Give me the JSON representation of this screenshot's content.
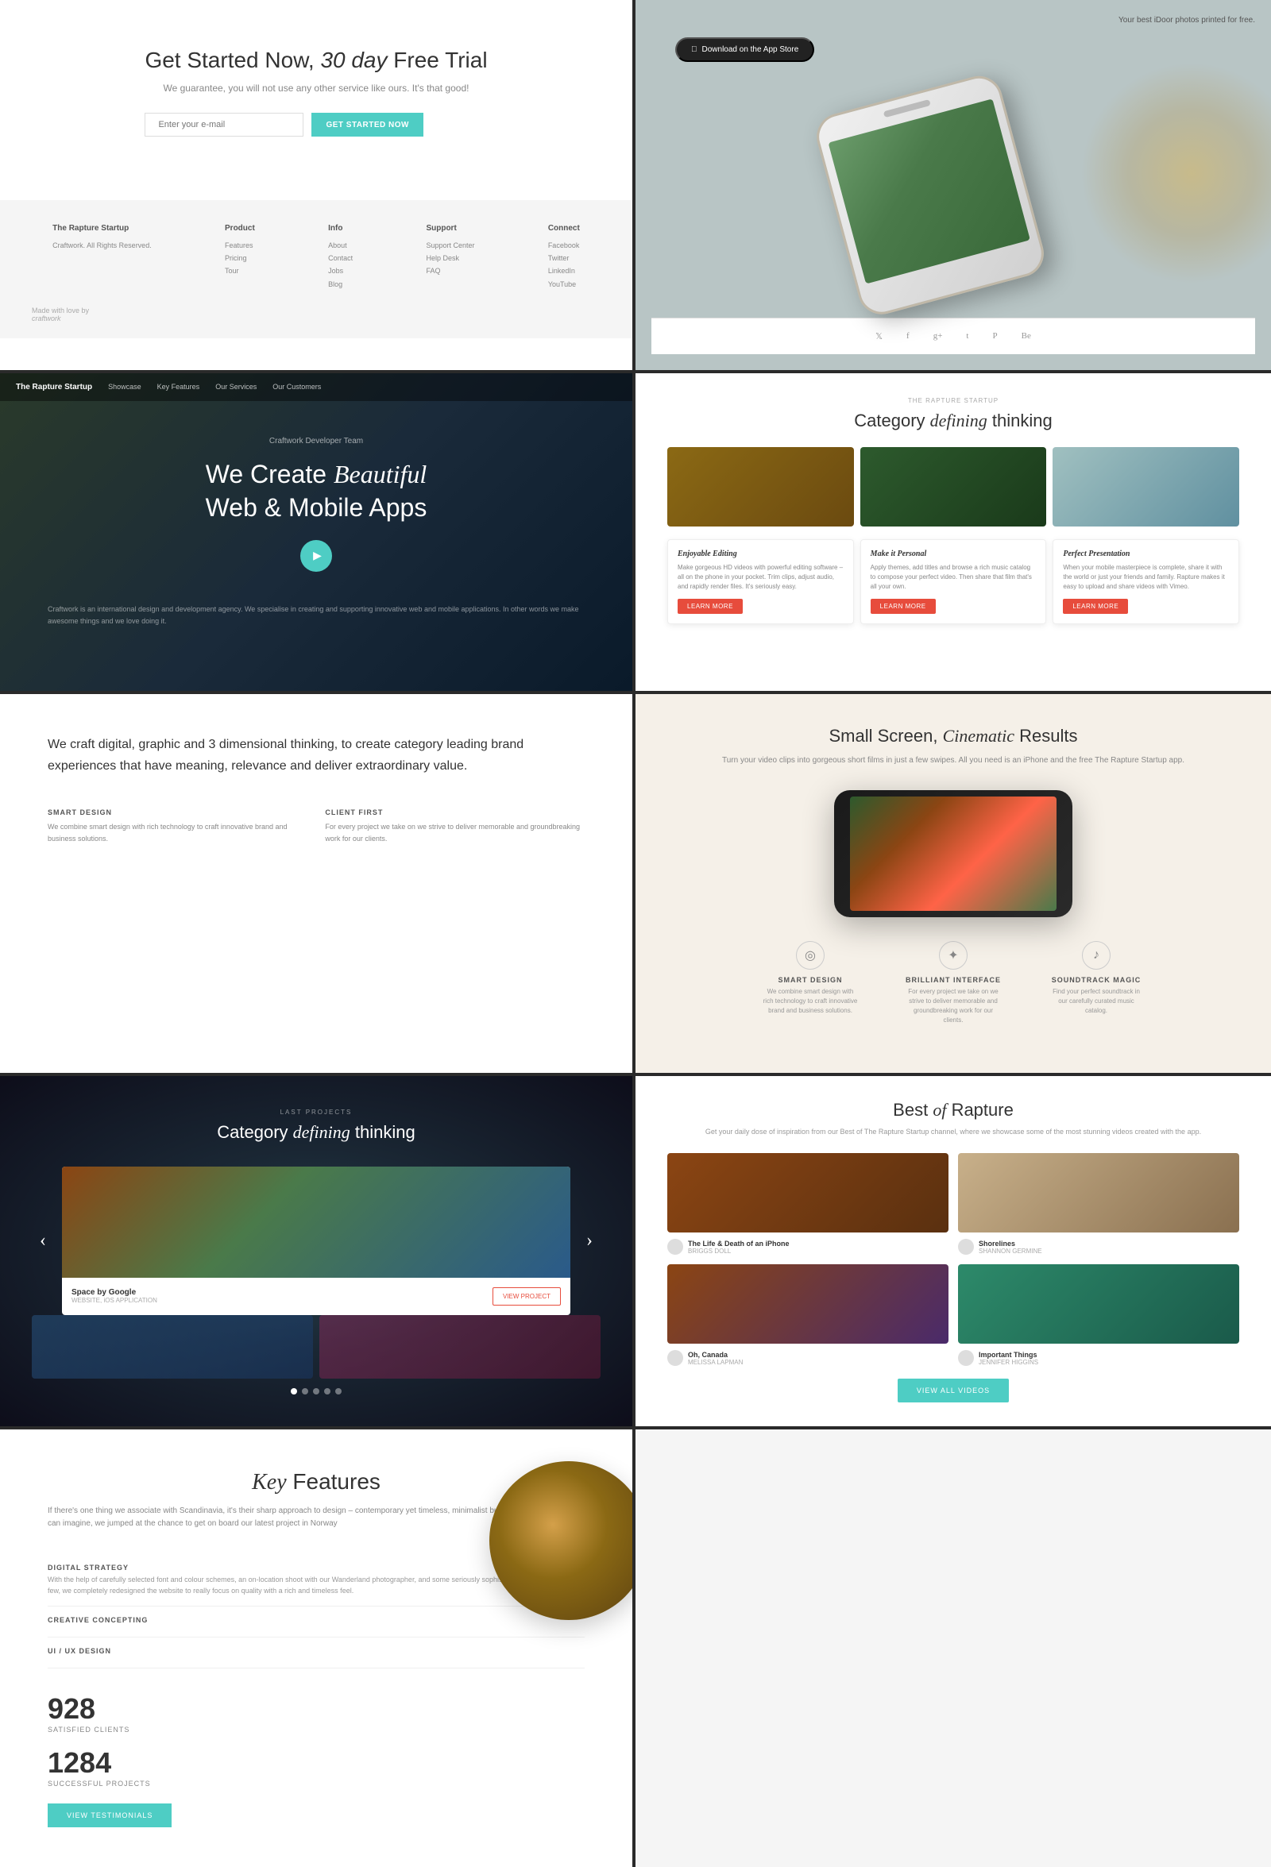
{
  "panel1": {
    "headline": "Get Started Now,",
    "headline_em": "30 day",
    "headline_end": "Free Trial",
    "subtitle": "We guarantee, you will not use any other service like ours. It's that good!",
    "email_placeholder": "Enter your e-mail",
    "cta_button": "GET STARTED NOW",
    "footer_brand": "The Rapture Startup",
    "footer_copy": "Craftwork. All Rights Reserved.",
    "footer_cols": [
      {
        "heading": "The Rapture Startup",
        "links": [
          "Craftwork. All Rights Reserved."
        ]
      },
      {
        "heading": "Product",
        "links": [
          "Features",
          "Pricing",
          "Tour"
        ]
      },
      {
        "heading": "Info",
        "links": [
          "About",
          "Contact",
          "Jobs",
          "Blog"
        ]
      },
      {
        "heading": "Support",
        "links": [
          "Support Center",
          "Help Desk",
          "FAQ"
        ]
      },
      {
        "heading": "Connect",
        "links": [
          "Facebook",
          "Twitter",
          "LinkedIn",
          "YouTube"
        ]
      }
    ],
    "logo": "craftwork"
  },
  "panel2": {
    "top_text": "Your best iDoor photos printed for free.",
    "app_store": "Download on the App Store",
    "social_icons": [
      "twitter",
      "facebook",
      "google-plus",
      "tumblr",
      "pinterest",
      "behance"
    ]
  },
  "panel3": {
    "nav_brand": "The Rapture Startup",
    "nav_links": [
      "Showcase",
      "Key Features",
      "Our Services",
      "Our Customers"
    ],
    "small_label": "Craftwork Developer Team",
    "headline": "We Create",
    "headline_em": "Beautiful",
    "headline_line2": "Web & Mobile Apps",
    "body_text": "Craftwork is an international design and development agency. We specialise in creating and supporting innovative web and mobile applications. In other words we make awesome things and we love doing it."
  },
  "panel4": {
    "brand": "THE RAPTURE STARTUP",
    "headline": "Category",
    "headline_em": "defining",
    "headline_end": "thinking",
    "cards": [
      {
        "title": "Enjoyable Editing",
        "desc": "Make gorgeous HD videos with powerful editing software – all on the phone in your pocket. Trim clips, adjust audio, and rapidly render files. It's seriously easy.",
        "btn": "LEARN MORE"
      },
      {
        "title": "Make it Personal",
        "desc": "Apply themes, add titles and browse a rich music catalog to compose your perfect video. Then share that film that's all your own.",
        "btn": "LEARN MORE"
      },
      {
        "title": "Perfect Presentation",
        "desc": "When your mobile masterpiece is complete, share it with the world or just your friends and family. Rapture makes it easy to upload and share videos with Vimeo.",
        "btn": "LEARN MORE"
      }
    ]
  },
  "panel5": {
    "main_text": "We craft digital, graphic and 3 dimensional thinking, to create category leading brand experiences that have meaning, relevance and deliver extraordinary value.",
    "col1_title": "SMART DESIGN",
    "col1_text": "We combine smart design with rich technology to craft innovative brand and business solutions.",
    "col2_title": "CLIENT FIRST",
    "col2_text": "For every project we take on we strive to deliver memorable and groundbreaking work for our clients."
  },
  "panel6": {
    "headline": "Small Screen,",
    "headline_em": "Cinematic",
    "headline_end": "Results",
    "subtitle": "Turn your video clips into gorgeous short films in just a few swipes.\nAll you need is an iPhone and the free The Rapture Startup app.",
    "features": [
      {
        "icon": "◎",
        "title": "SMART DESIGN",
        "desc": "We combine smart design with rich technology to craft innovative brand and business solutions."
      },
      {
        "icon": "✦",
        "title": "BRILLIANT INTERFACE",
        "desc": "For every project we take on we strive to deliver memorable and groundbreaking work for our clients."
      },
      {
        "icon": "♪",
        "title": "SOUNDTRACK MAGIC",
        "desc": "Find your perfect soundtrack in our carefully curated music catalog."
      }
    ]
  },
  "panel7": {
    "small_label": "LAST PROJECTS",
    "headline": "Category",
    "headline_em": "defining",
    "headline_end": "thinking",
    "card_title": "Space by Google",
    "card_sub": "WEBSITE, iOS APPLICATION",
    "card_btn": "VIEW PROJECT",
    "dots": [
      true,
      false,
      false,
      false,
      false
    ]
  },
  "panel8": {
    "headline": "Best",
    "headline_em": "of",
    "headline_end": "Rapture",
    "subtitle": "Get your daily dose of inspiration from our Best of The Rapture Startup channel, where\nwe showcase some of the most stunning videos created with the app.",
    "videos": [
      {
        "title": "The Life & Death of an iPhone",
        "author": "BRIGGS DOLL"
      },
      {
        "title": "Shorelines",
        "author": "SHANNON GERMINE"
      },
      {
        "title": "Oh, Canada",
        "author": "MELISSA LAPMAN"
      },
      {
        "title": "Important Things",
        "author": "JENNIFER HIGGINS"
      }
    ],
    "view_btn": "VIEW ALL VIDEOS"
  },
  "panel9": {
    "headline": "Key",
    "headline_em": "Key",
    "headline_rest": "Features",
    "desc": "If there's one thing we associate with Scandinavia, it's their sharp approach to design – contemporary yet timeless, minimalist but ever stylish. So, as you can imagine, we jumped at the chance to get on board our latest project in Norway",
    "features": [
      {
        "title": "DIGITAL STRATEGY",
        "desc": "With the help of carefully selected font and colour schemes, an on-location shoot with our Wanderland photographer, and some seriously sophisticated copy – to name a few, we completely redesigned the website to really focus on quality with a rich and timeless feel."
      },
      {
        "title": "CREATIVE CONCEPTING",
        "desc": ""
      },
      {
        "title": "UI / UX DESIGN",
        "desc": ""
      }
    ],
    "stats": [
      {
        "number": "928",
        "label": "SATISFIED CLIENTS"
      },
      {
        "number": "1284",
        "label": "SUCCESSFUL PROJECTS"
      }
    ],
    "testimonials_btn": "VIEW TESTIMONIALS"
  }
}
